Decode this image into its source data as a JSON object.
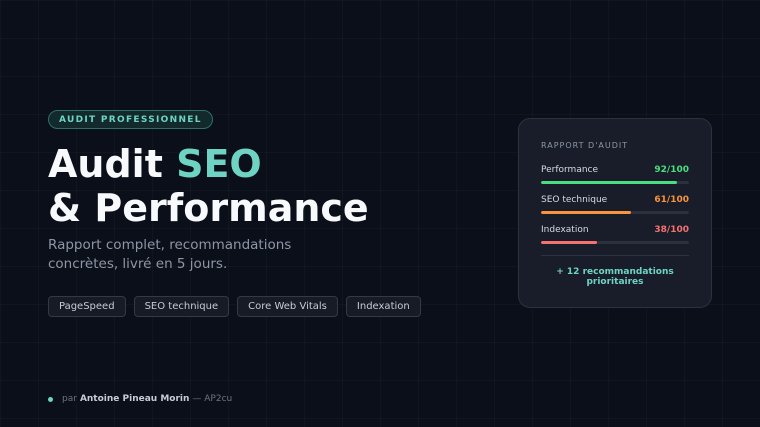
{
  "badge": "AUDIT PROFESSIONNEL",
  "title": {
    "line1": "Audit ",
    "accent": "SEO",
    "line2": "& Performance"
  },
  "subtitle": "Rapport complet, recommandations concrètes, livré en 5 jours.",
  "tags": [
    "PageSpeed",
    "SEO technique",
    "Core Web Vitals",
    "Indexation"
  ],
  "author": {
    "prefix": "par",
    "name": "Antoine Pineau Morin",
    "suffix": "— AP2cu"
  },
  "report": {
    "title": "RAPPORT D'AUDIT",
    "metrics": [
      {
        "label": "Performance",
        "score": "92/100",
        "value": 92,
        "color": "#4ade80"
      },
      {
        "label": "SEO technique",
        "score": "61/100",
        "value": 61,
        "color": "#fb923c"
      },
      {
        "label": "Indexation",
        "score": "38/100",
        "value": 38,
        "color": "#f87171"
      }
    ],
    "recommendations": "+ 12 recommandations prioritaires"
  },
  "colors": {
    "accent": "#6fd3c3",
    "background": "#0b0f19"
  }
}
